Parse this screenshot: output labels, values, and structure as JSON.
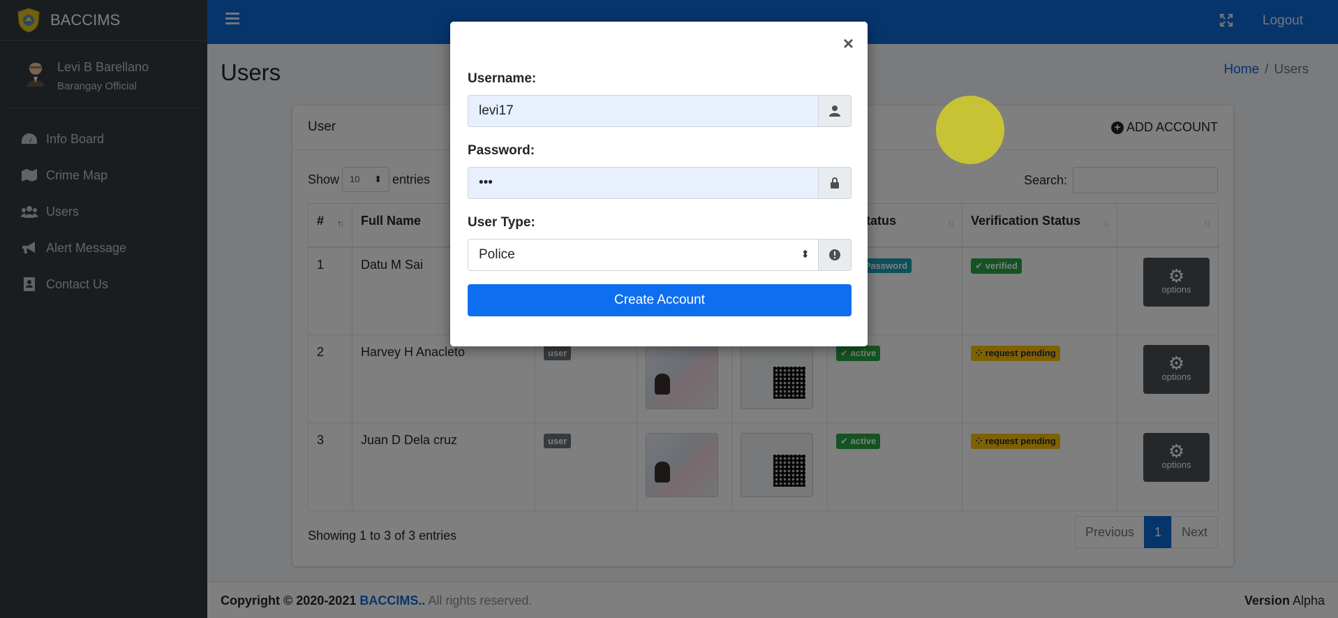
{
  "app": {
    "brand": "BACCIMS"
  },
  "user": {
    "name": "Levi B Barellano",
    "role": "Barangay Official"
  },
  "sidebar": {
    "items": [
      {
        "label": "Info Board",
        "icon": "tachometer-icon"
      },
      {
        "label": "Crime Map",
        "icon": "map-icon"
      },
      {
        "label": "Users",
        "icon": "users-icon"
      },
      {
        "label": "Alert Message",
        "icon": "bullhorn-icon"
      },
      {
        "label": "Contact Us",
        "icon": "contact-book-icon"
      }
    ]
  },
  "topbar": {
    "logout": "Logout"
  },
  "page": {
    "title": "Users"
  },
  "breadcrumb": {
    "home": "Home",
    "sep": "/",
    "current": "Users"
  },
  "card": {
    "title": "User",
    "add_account": "ADD ACCOUNT",
    "show": "Show",
    "entries_value": "10",
    "entries": "entries",
    "search_label": "Search:"
  },
  "table": {
    "headers": [
      "#",
      "Full Name",
      "",
      "",
      "",
      "unt status",
      "Verification Status",
      ""
    ],
    "rows": [
      {
        "num": "1",
        "name": "Datu M Sai",
        "account_status": "eting Password",
        "verification": "verified"
      },
      {
        "num": "2",
        "name": "Harvey H Anacleto",
        "type": "user",
        "account_status": "active",
        "verification": "request pending"
      },
      {
        "num": "3",
        "name": "Juan D Dela cruz",
        "type": "user",
        "account_status": "active",
        "verification": "request pending"
      }
    ],
    "options_label": "options"
  },
  "table_footer": {
    "info": "Showing 1 to 3 of 3 entries",
    "prev": "Previous",
    "page": "1",
    "next": "Next"
  },
  "footer": {
    "copyright": "Copyright © 2020-2021",
    "brand": "BACCIMS..",
    "rights": "All rights reserved.",
    "version_label": "Version",
    "version": "Alpha"
  },
  "modal": {
    "close": "×",
    "username_label": "Username:",
    "username_value": "levi17",
    "password_label": "Password:",
    "password_value": "•••",
    "usertype_label": "User Type:",
    "usertype_value": "Police",
    "submit": "Create Account"
  },
  "colors": {
    "primary": "#0d6ad9",
    "sidebar": "#343a40",
    "success": "#28a745",
    "warning": "#ffc107",
    "info": "#17a2b8"
  }
}
